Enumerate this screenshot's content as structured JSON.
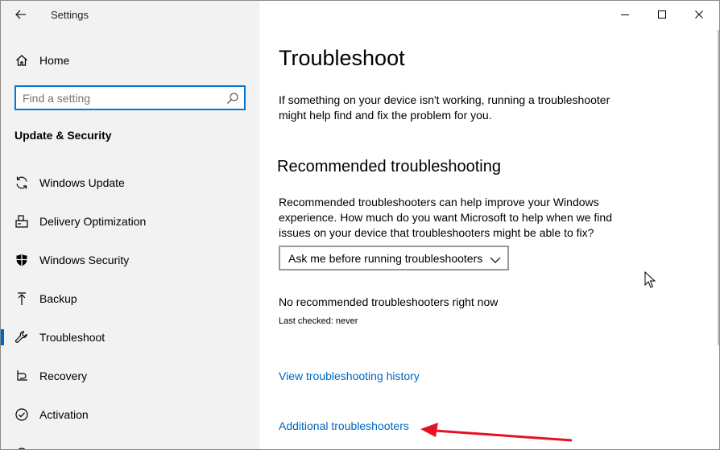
{
  "window": {
    "app_title": "Settings"
  },
  "sidebar": {
    "home_label": "Home",
    "search": {
      "placeholder": "Find a setting",
      "value": ""
    },
    "section_heading": "Update & Security",
    "items": [
      {
        "label": "Windows Update",
        "icon": "sync-icon"
      },
      {
        "label": "Delivery Optimization",
        "icon": "delivery-optimization-icon"
      },
      {
        "label": "Windows Security",
        "icon": "shield-icon"
      },
      {
        "label": "Backup",
        "icon": "backup-arrow-icon"
      },
      {
        "label": "Troubleshoot",
        "icon": "wrench-icon",
        "active": true
      },
      {
        "label": "Recovery",
        "icon": "recovery-icon"
      },
      {
        "label": "Activation",
        "icon": "activation-icon"
      }
    ]
  },
  "main": {
    "title": "Troubleshoot",
    "intro_line1": "If something on your device isn't working, running a troubleshooter",
    "intro_line2": "might help find and fix the problem for you.",
    "recommended": {
      "heading": "Recommended troubleshooting",
      "desc_line1": "Recommended troubleshooters can help improve your Windows",
      "desc_line2": "experience. How much do you want Microsoft to help when we find",
      "desc_line3": "issues on your device that troubleshooters might be able to fix?",
      "dropdown_value": "Ask me before running troubleshooters",
      "status": "No recommended troubleshooters right now",
      "last_checked": "Last checked: never"
    },
    "history_link": "View troubleshooting history",
    "additional_link": "Additional troubleshooters"
  },
  "colors": {
    "accent": "#0078d4",
    "link": "#0067c0",
    "annotation_arrow": "#e81123",
    "sidebar_bg": "#f2f2f2"
  }
}
